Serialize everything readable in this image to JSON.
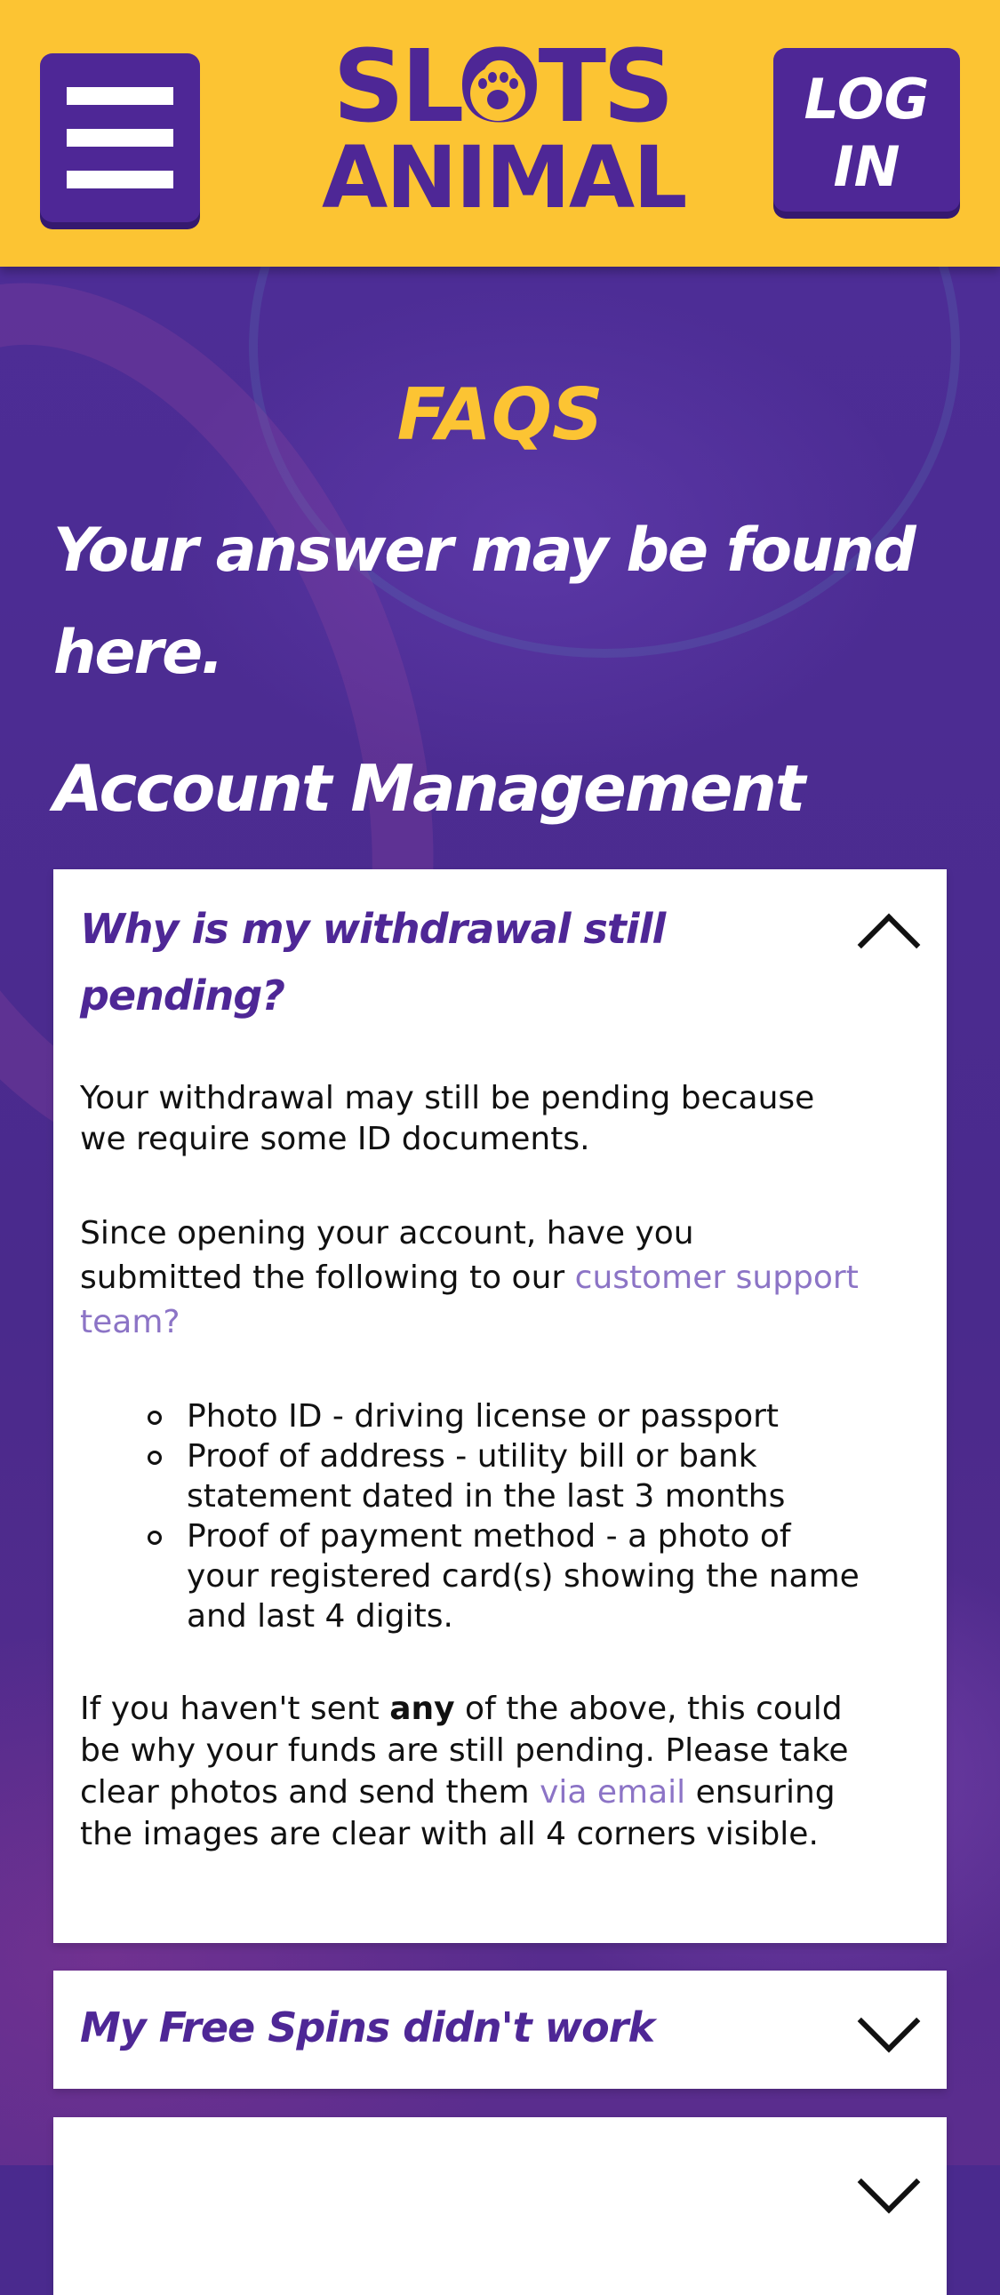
{
  "header": {
    "menu_icon": "hamburger-menu-icon",
    "logo_line1": "SLOTS",
    "logo_line2": "ANIMAL",
    "logo_icon": "paw-icon",
    "login_label_line1": "LOG",
    "login_label_line2": "IN"
  },
  "page": {
    "title": "FAQS",
    "subtitle": "Your answer may be found here.",
    "section_title": "Account Management"
  },
  "faqs": [
    {
      "question": "Why is my withdrawal still pending?",
      "expanded": true,
      "answer": {
        "p1": "Your withdrawal may still be pending because we require some ID documents.",
        "p2_text": "Since opening your account, have you submitted the following to our ",
        "p2_link": "customer support team?",
        "list": [
          "Photo ID - driving license or passport",
          "Proof of address - utility bill or bank statement dated in the last 3 months",
          "Proof of payment method - a photo of your registered card(s) showing the name and last 4 digits."
        ],
        "p3_before": "If you haven't sent ",
        "p3_bold": "any",
        "p3_middle": " of the above, this could be why your funds are still pending. Please take clear photos and send them ",
        "p3_link": "via email",
        "p3_after": " ensuring the images are clear with all 4 corners visible."
      }
    },
    {
      "question": "My Free Spins didn't work",
      "expanded": false
    },
    {
      "question": "",
      "expanded": false
    }
  ],
  "colors": {
    "header_bg": "#fcc433",
    "brand_purple": "#4e2796",
    "page_bg": "#4a2a8e",
    "link": "#8c74c6"
  }
}
